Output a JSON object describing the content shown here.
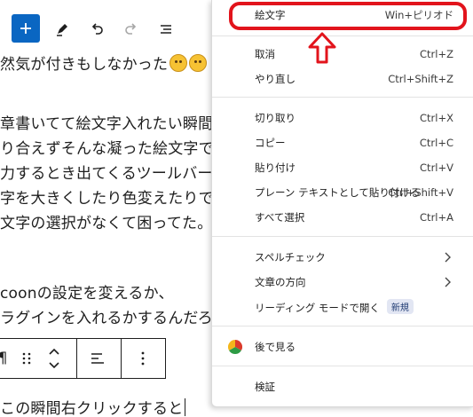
{
  "editor": {
    "lines": [
      {
        "text": "然気が付きもしなかった",
        "emoji": true
      },
      {
        "text": ""
      },
      {
        "text": "章書いてて絵文字入れたい瞬間"
      },
      {
        "text": "り合えずそんな凝った絵文字で"
      },
      {
        "text": "力するとき出てくるツールバー"
      },
      {
        "text": "字を大きくしたり色変えたりで"
      },
      {
        "text": "文字の選択がなくて困ってた。"
      },
      {
        "text": ""
      },
      {
        "text": "coonの設定を変えるか、"
      },
      {
        "text": "ラグインを入れるかするんだろ"
      }
    ],
    "block_toolbar_left_label": "¶",
    "last_line": "この瞬間右クリックすると"
  },
  "menu": {
    "items": [
      {
        "label": "絵文字",
        "shortcut": "Win+ピリオド"
      },
      {
        "label": "取消",
        "shortcut": "Ctrl+Z"
      },
      {
        "label": "やり直し",
        "shortcut": "Ctrl+Shift+Z"
      },
      {
        "label": "切り取り",
        "shortcut": "Ctrl+X"
      },
      {
        "label": "コピー",
        "shortcut": "Ctrl+C"
      },
      {
        "label": "貼り付け",
        "shortcut": "Ctrl+V"
      },
      {
        "label": "プレーン テキストとして貼り付ける",
        "shortcut": "Ctrl+Shift+V"
      },
      {
        "label": "すべて選択",
        "shortcut": "Ctrl+A"
      },
      {
        "label": "スペルチェック",
        "shortcut": ""
      },
      {
        "label": "文章の方向",
        "shortcut": ""
      },
      {
        "label": "リーディング モードで開く",
        "badge": "新規"
      },
      {
        "label": "後で見る"
      },
      {
        "label": "検証"
      }
    ]
  },
  "colors": {
    "accent": "#0a66c2",
    "highlight": "#e2141c",
    "badge_bg": "#e2e6f3"
  }
}
